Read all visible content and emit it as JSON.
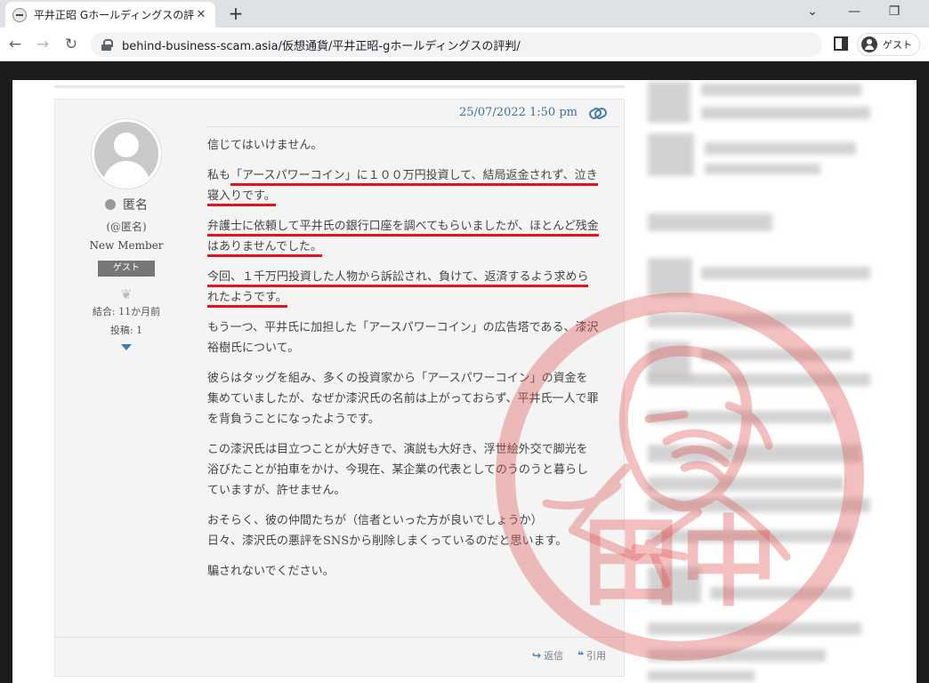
{
  "browser": {
    "tab_title": "平井正昭 Gホールディングスの評判 -",
    "tab_close": "✕",
    "new_tab": "+",
    "url": "behind-business-scam.asia/仮想通貨/平井正昭-gホールディングスの評判/",
    "profile_label": "ゲスト",
    "window_controls": [
      "⌄",
      "—",
      "❐"
    ]
  },
  "comment": {
    "author": {
      "name": "匿名",
      "handle": "(@匿名)",
      "role": "New Member",
      "badge": "ゲスト",
      "joined": "結合: 11か月前",
      "posts": "投稿: 1"
    },
    "date": "25/07/2022 1:50 pm",
    "paragraphs": {
      "p1": "信じてはいけません。",
      "p2a": "私も",
      "p2b": "「アースパワーコイン」に１００万円投資して、結局返金されず、泣き寝入りです。",
      "p3": "弁護士に依頼して平井氏の銀行口座を調べてもらいましたが、ほとんど残金はありませんでした。",
      "p4": "今回、１千万円投資した人物から訴訟され、負けて、返済するよう求められたようです。",
      "p5": "もう一つ、平井氏に加担した「アースパワーコイン」の広告塔である、漆沢裕樹氏について。",
      "p6": "彼らはタッグを組み、多くの投資家から「アースパワーコイン」の資金を集めていましたが、なぜか漆沢氏の名前は上がっておらず、平井氏一人で罪を背負うことになったようです。",
      "p7": "この漆沢氏は目立つことが大好きで、演説も大好き、浮世絵外交で脚光を浴びたことが拍車をかけ、今現在、某企業の代表としてのうのうと暮らしていますが、許せません。",
      "p8a": "おそらく、彼の仲間たちが（信者といった方が良いでしょうか）",
      "p8b": "日々、漆沢氏の悪評をSNSから削除しまくっているのだと思います。",
      "p9": "騙されないでください。"
    },
    "reply_label": "返信",
    "quote_label": "引用"
  },
  "stamp": {
    "text": "田中",
    "color": "#e05a5a"
  }
}
